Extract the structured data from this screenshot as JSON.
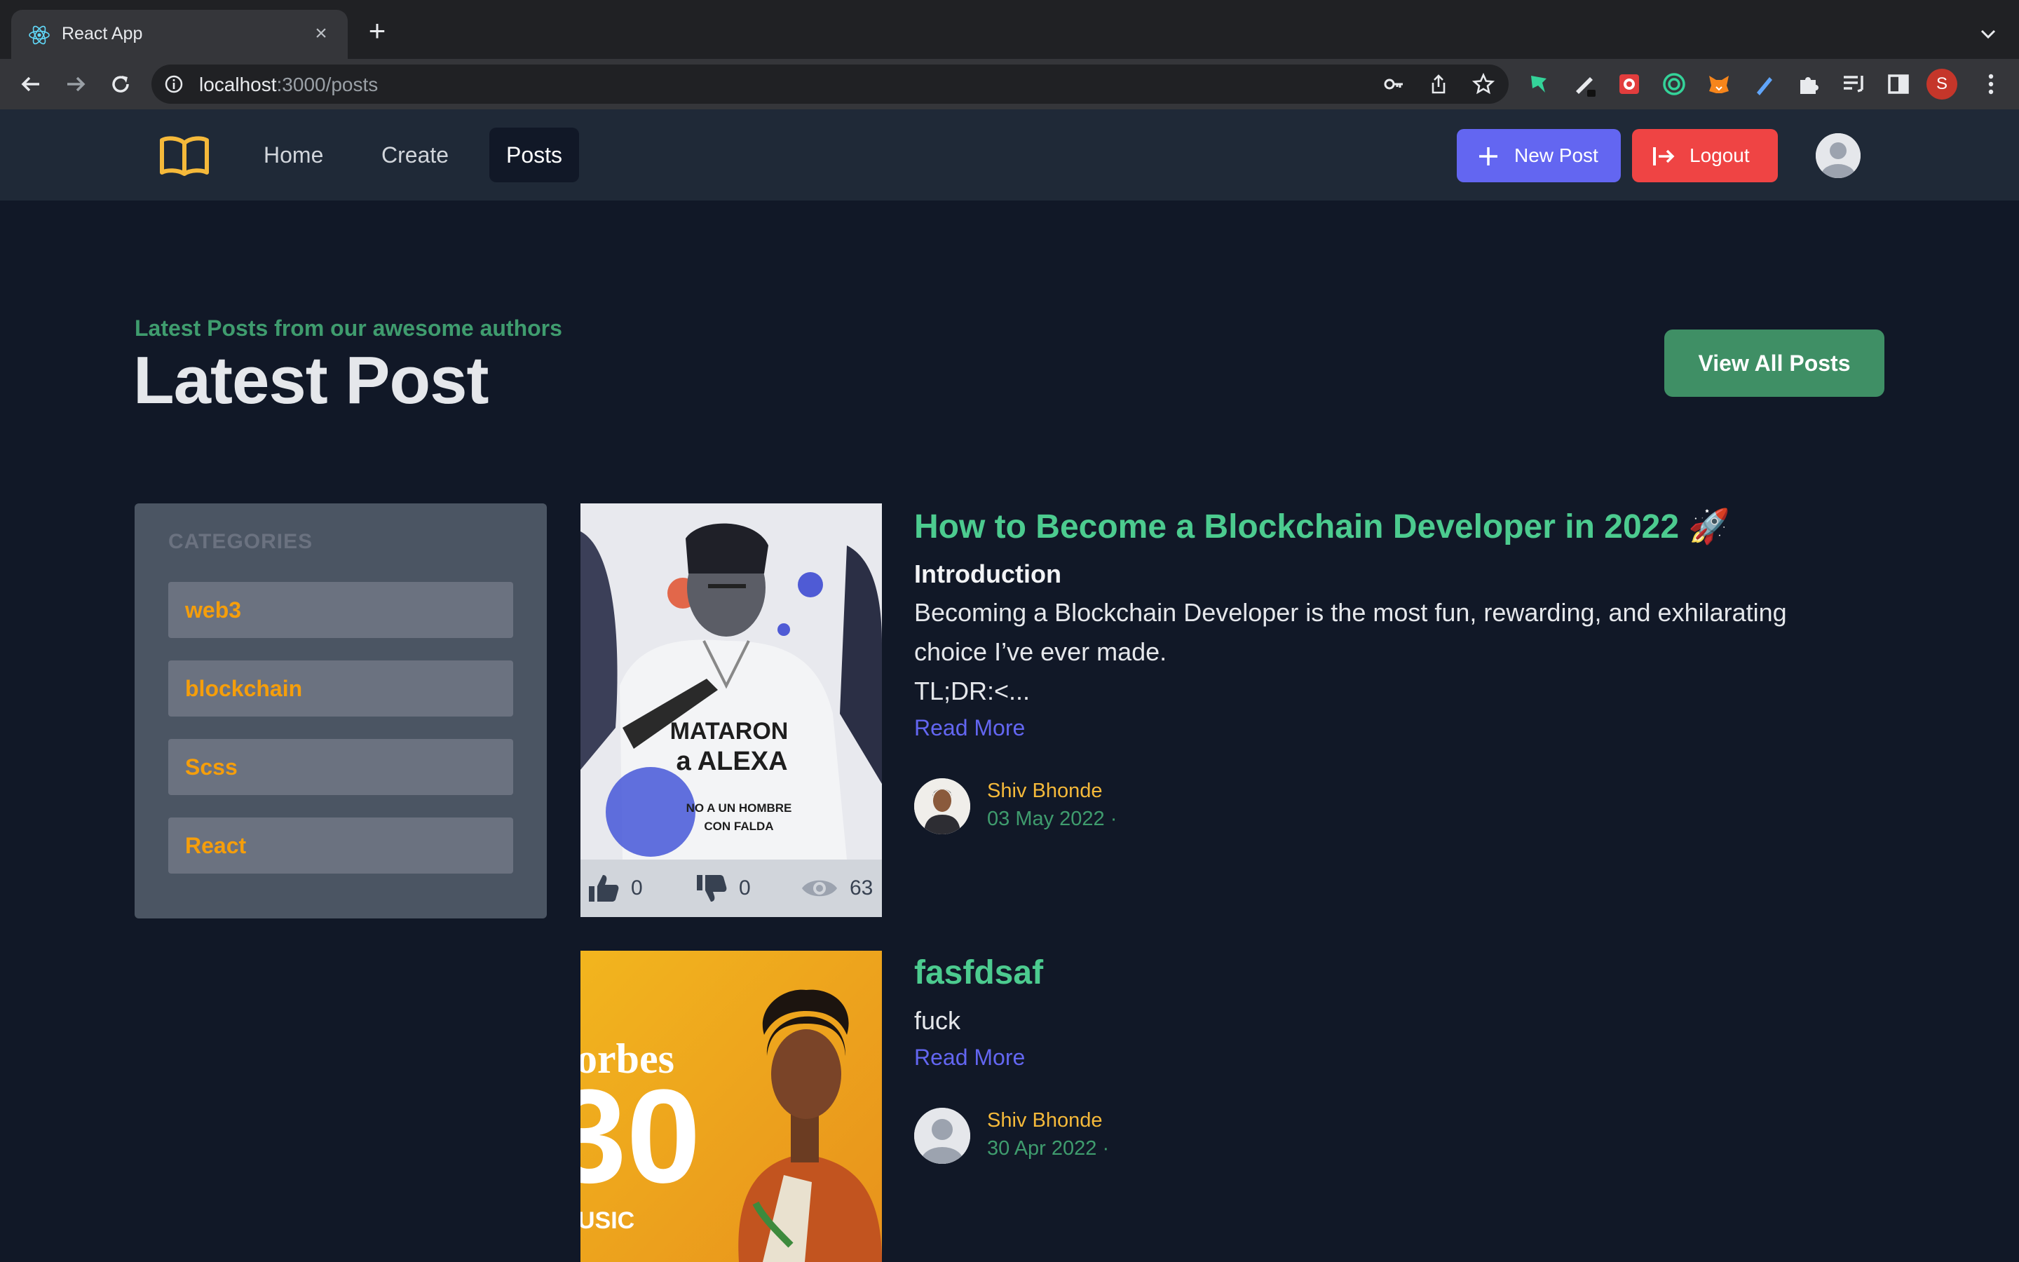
{
  "browser": {
    "tab_title": "React App",
    "url_host": "localhost",
    "url_path": ":3000/posts",
    "profile_initial": "S"
  },
  "nav": {
    "links": [
      {
        "label": "Home",
        "active": false
      },
      {
        "label": "Create",
        "active": false
      },
      {
        "label": "Posts",
        "active": true
      }
    ],
    "new_post_label": "New Post",
    "logout_label": "Logout"
  },
  "header": {
    "eyebrow": "Latest Posts from our awesome authors",
    "title": "Latest Post",
    "view_all_label": "View All Posts"
  },
  "categories": {
    "title": "CATEGORIES",
    "items": [
      "web3",
      "blockchain",
      "Scss",
      "React"
    ]
  },
  "posts": [
    {
      "title": "How to Become a Blockchain Developer in 2022 🚀",
      "subtitle": "Introduction",
      "excerpt_lines": [
        "Becoming a Blockchain Developer is the most fun, rewarding, and exhilarating",
        "choice I’ve ever made.",
        "TL;DR:<..."
      ],
      "read_more": "Read More",
      "likes": "0",
      "dislikes": "0",
      "views": "63",
      "author": "Shiv Bhonde",
      "date": "03 May 2022 ·",
      "image_text": [
        "MATARON",
        "a ALEXA",
        "NO A UN HOMBRE",
        "CON FALDA"
      ]
    },
    {
      "title": "fasfdsaf",
      "excerpt_lines": [
        "fuck"
      ],
      "read_more": "Read More",
      "author": "Shiv Bhonde",
      "date": "30 Apr 2022 ·",
      "image_text": [
        "orbes",
        "30",
        "USIC"
      ]
    }
  ]
}
